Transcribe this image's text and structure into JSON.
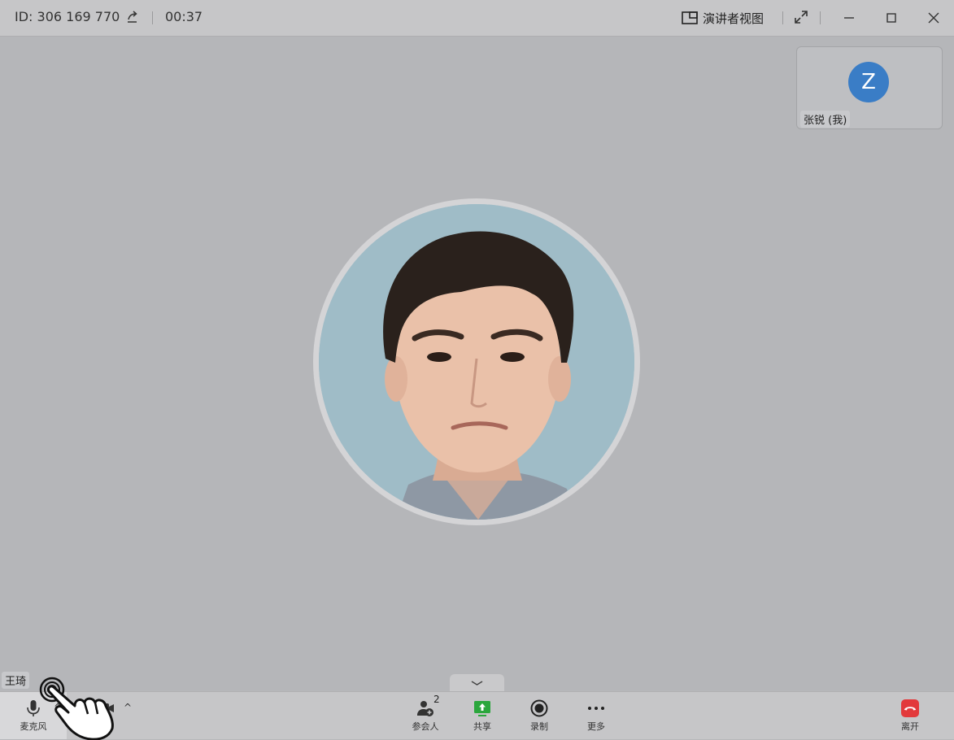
{
  "header": {
    "meeting_id": "ID:  306 169 770",
    "timer": "00:37",
    "speaker_view_label": "演讲者视图"
  },
  "self_tile": {
    "avatar_letter": "Z",
    "name": "张锐 (我)"
  },
  "active_speaker": {
    "name": "王琦"
  },
  "toolbar": {
    "mic_label": "麦克风",
    "video_label": "头",
    "participants_label": "参会人",
    "participants_count": "2",
    "share_label": "共享",
    "record_label": "录制",
    "more_label": "更多",
    "leave_label": "离开"
  },
  "colors": {
    "share_green": "#2aa63c",
    "leave_red": "#e2393b",
    "avatar_blue": "#3a7dc6"
  }
}
